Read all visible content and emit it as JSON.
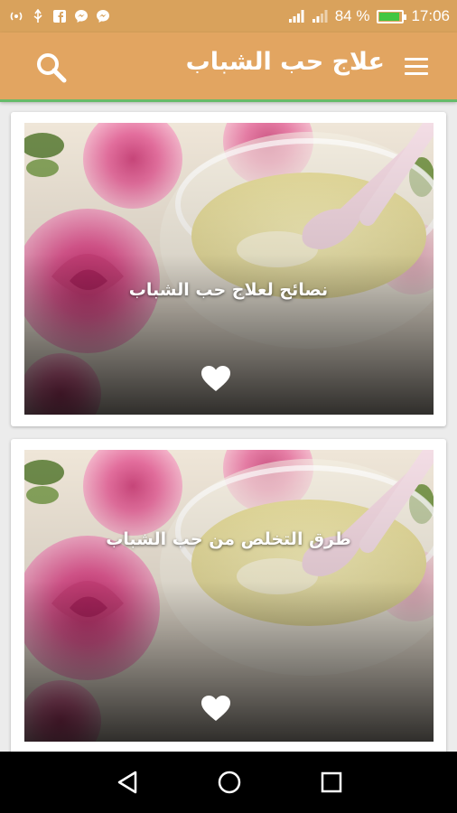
{
  "status_bar": {
    "battery_text": "84 %",
    "time": "17:06",
    "battery_level": 0.84
  },
  "app_bar": {
    "title": "علاج حب الشباب",
    "menu_icon": "hamburger-menu-icon",
    "search_icon": "search-icon"
  },
  "cards": [
    {
      "title": "نصائح لعلاج حب الشباب",
      "favorite_icon": "heart-icon"
    },
    {
      "title": "طرق التخلص من حب الشباب",
      "favorite_icon": "heart-icon"
    }
  ],
  "nav_bar": {
    "back_icon": "back-triangle-icon",
    "home_icon": "home-circle-icon",
    "recents_icon": "recents-square-icon"
  },
  "colors": {
    "app_bar": "#e2a561",
    "status_bar": "#d9a25c",
    "accent_line": "#66bb6a"
  }
}
